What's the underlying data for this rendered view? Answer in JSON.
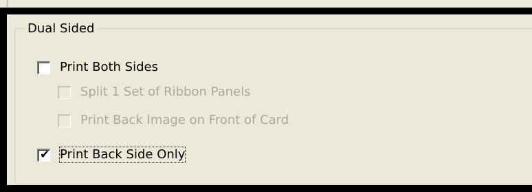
{
  "groupbox": {
    "title": "Dual Sided"
  },
  "options": [
    {
      "label": "Print Both Sides",
      "checked": false,
      "enabled": true
    },
    {
      "label": "Split 1 Set of Ribbon Panels",
      "checked": false,
      "enabled": false
    },
    {
      "label": "Print Back Image on Front of Card",
      "checked": false,
      "enabled": false
    },
    {
      "label": "Print Back Side Only",
      "checked": true,
      "enabled": true
    }
  ],
  "icons": {
    "check": "✔"
  }
}
